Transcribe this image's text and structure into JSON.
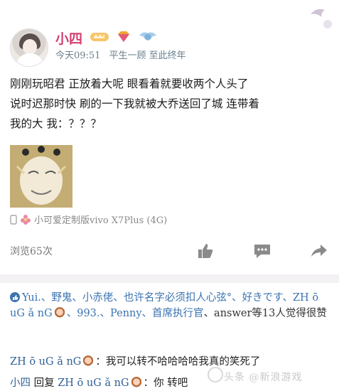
{
  "user": {
    "name": "小四",
    "time": "今天09:51",
    "signature": "平生一顾 至此终年"
  },
  "post": {
    "text": "刚刚玩昭君 正放着大呢 眼看着就要收两个人头了\n说时迟那时快 刷的一下我就被大乔送回了城 连带着\n我的大 我：？？？",
    "device": "小可爱定制版vivo X7Plus (4G)"
  },
  "stats": {
    "views": "浏览65次"
  },
  "likes": {
    "names": "Yui.、野鬼、小赤佬、也许名字必须扣人心弦°、好きです、ZH ō uG ǎ nG",
    "names2": "、993.、Penny、首席执行官",
    "tail": "、answer等13人觉得很赞"
  },
  "comments": [
    {
      "user": "ZH ō uG ǎ nG",
      "sep": "：",
      "text": "我可以转不哈哈哈哈我真的笑死了"
    },
    {
      "user": "小四",
      "reply": "回复",
      "target": "ZH ō uG ǎ nG",
      "sep": "：",
      "text": "你 转吧"
    }
  ],
  "watermark": {
    "text": "头条 @新浪游戏"
  },
  "colors": {
    "username": "#d23f72",
    "link": "#3a73b0",
    "meta": "#6b7f8e"
  },
  "icons": [
    "bird-icon",
    "level-badge-icon",
    "diamond-icon",
    "wings-badge-icon",
    "phone-icon",
    "flower-icon",
    "thumbs-up-icon",
    "comment-icon",
    "share-icon",
    "like-small-icon"
  ]
}
